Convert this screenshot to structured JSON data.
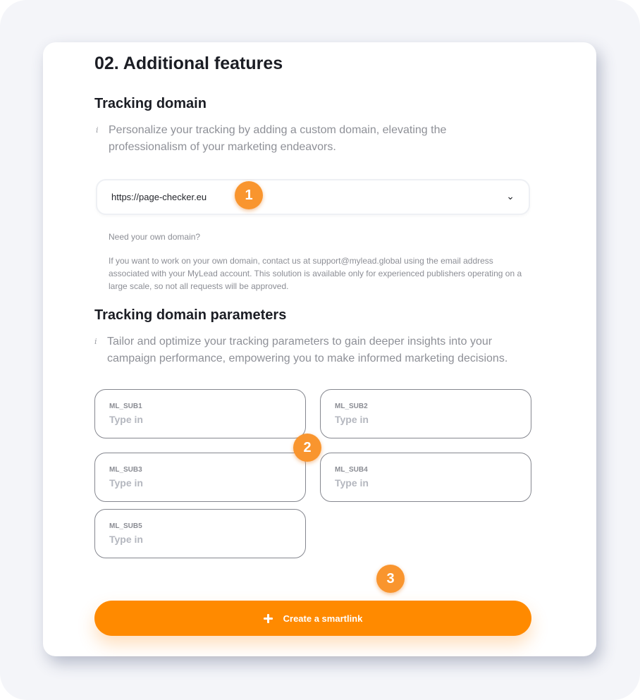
{
  "section": {
    "title": "02. Additional features"
  },
  "tracking_domain": {
    "title": "Tracking domain",
    "info_icon": "info-icon",
    "description_lines": [
      "Personalize your tracking by adding a custom domain, elevating the",
      "professionalism of your marketing endeavors."
    ],
    "selected_domain": "https://page-checker.eu",
    "dropdown_icon": "chevron-down-icon",
    "note_title": "Need your own domain?",
    "note_lines": [
      "If you want to work on your own domain, contact us at support@mylead.global using the email address",
      "associated with your MyLead account. This solution is available only for experienced publishers operating on a",
      "large scale, so not all requests will be approved."
    ]
  },
  "tracking_params": {
    "title": "Tracking domain parameters",
    "info_icon": "info-icon",
    "description_lines": [
      "Tailor and optimize your tracking parameters to gain deeper insights into your",
      "campaign performance, empowering you to make informed marketing decisions."
    ],
    "fields": [
      {
        "label": "ML_SUB1",
        "placeholder": "Type in",
        "value": ""
      },
      {
        "label": "ML_SUB2",
        "placeholder": "Type in",
        "value": ""
      },
      {
        "label": "ML_SUB3",
        "placeholder": "Type in",
        "value": ""
      },
      {
        "label": "ML_SUB4",
        "placeholder": "Type in",
        "value": ""
      },
      {
        "label": "ML_SUB5",
        "placeholder": "Type in",
        "value": ""
      }
    ]
  },
  "markers": [
    "1",
    "2",
    "3"
  ],
  "cta": {
    "label": "Create a smartlink",
    "icon": "plus-icon",
    "color": "#ff8a00"
  },
  "colors": {
    "accent": "#ff8a00",
    "marker": "#f9952e",
    "background": "#f4f5f9"
  }
}
